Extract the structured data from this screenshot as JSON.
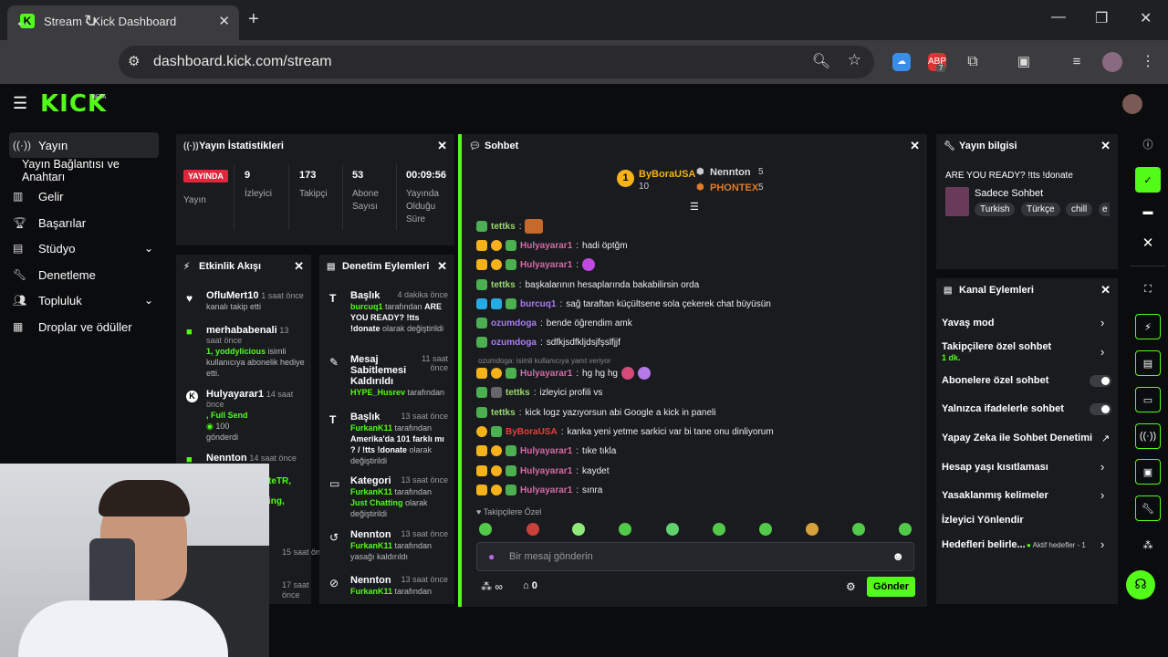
{
  "browser": {
    "tab_title": "Stream - Kick Dashboard",
    "url": "dashboard.kick.com/stream",
    "ext_badge": "7"
  },
  "header": {
    "logo": "KICK",
    "beta": "BETA"
  },
  "nav": {
    "items": [
      {
        "label": "Yayın",
        "icon": "broadcast-icon"
      },
      {
        "label": "Yayın Bağlantısı ve Anahtarı",
        "icon": ""
      },
      {
        "label": "Gelir",
        "icon": "chart-icon"
      },
      {
        "label": "Başarılar",
        "icon": "trophy-icon"
      },
      {
        "label": "Stüdyo",
        "icon": "studio-icon"
      },
      {
        "label": "Denetleme",
        "icon": "wrench-icon"
      },
      {
        "label": "Topluluk",
        "icon": "people-icon"
      },
      {
        "label": "Droplar ve ödüller",
        "icon": "gift-icon"
      }
    ]
  },
  "stats": {
    "title": "Yayın İstatistikleri",
    "live_badge": "YAYINDA",
    "live_label": "Yayın",
    "viewers": "9",
    "viewers_label": "İzleyici",
    "followers": "173",
    "followers_label": "Takipçi",
    "subs": "53",
    "subs_label": "Abone Sayısı",
    "duration": "00:09:56",
    "duration_label": "Yayında Olduğu Süre"
  },
  "activity": {
    "title": "Etkinlik Akışı",
    "items": [
      {
        "user": "OfluMert10",
        "time": "1 saat önce",
        "desc": "kanalı takip etti"
      },
      {
        "user": "merhababenali",
        "time": "13 saat önce",
        "hl": "1, yoddylicious",
        "desc": " isimli kullanıcıya abonelik hediye etti."
      },
      {
        "user": "Hulyayarar1",
        "time": "14 saat önce",
        "hl": ", Full Send",
        "desc": "100",
        "desc2": "gönderdi"
      },
      {
        "user": "Nennton",
        "time": "14 saat önce",
        "hl": "teTR,",
        "desc": ""
      },
      {
        "user": "",
        "time": "15 saat önce",
        "hl": "ing,",
        "desc": ""
      },
      {
        "user": "",
        "time": "17 saat önce",
        "hl": "",
        "desc": ""
      }
    ]
  },
  "moderation": {
    "title": "Denetim Eylemleri",
    "items": [
      {
        "action": "Başlık",
        "time": "4 dakika önce",
        "by": "burcuq1",
        "mid": " tarafından ",
        "bold": "ARE YOU READY? !tts !donate",
        "end": " olarak değiştirildi"
      },
      {
        "action": "Mesaj Sabitlemesi Kaldırıldı",
        "time": "11 saat önce",
        "by": "HYPE_Husrev",
        "mid": " tarafından",
        "bold": "",
        "end": ""
      },
      {
        "action": "Başlık",
        "time": "13 saat önce",
        "by": "FurkanK11",
        "mid": " tarafından ",
        "bold": "Amerika'da 101 farklı mı ? / !tts !donate",
        "end": " olarak değiştirildi"
      },
      {
        "action": "Kategori",
        "time": "13 saat önce",
        "by": "FurkanK11",
        "mid": " tarafından ",
        "bold": "Just Chatting",
        "end": " olarak değiştirildi"
      },
      {
        "action": "Nennton",
        "time": "13 saat önce",
        "by": "FurkanK11",
        "mid": " tarafından yasağı kaldırıldı",
        "bold": "",
        "end": ""
      },
      {
        "action": "Nennton",
        "time": "13 saat önce",
        "by": "FurkanK11",
        "mid": " tarafından",
        "bold": "",
        "end": ""
      }
    ]
  },
  "chat": {
    "title": "Sohbet",
    "top": [
      {
        "name": "ByBoraUSA",
        "count": "10"
      },
      {
        "name": "Nennton",
        "count": "5"
      },
      {
        "name": "PHONTEX",
        "count": "5"
      }
    ],
    "messages": [
      {
        "user": "tettks",
        "color": "green",
        "badges": [
          "money"
        ],
        "text": ""
      },
      {
        "user": "Hulyayarar1",
        "color": "pink",
        "badges": [
          "crown",
          "coin",
          "money"
        ],
        "text": "hadi öptğm"
      },
      {
        "user": "Hulyayarar1",
        "color": "pink",
        "badges": [
          "crown",
          "coin",
          "money"
        ],
        "text": ""
      },
      {
        "user": "tettks",
        "color": "green",
        "badges": [
          "money"
        ],
        "text": "başkalarının hesaplarında bakabilirsin orda"
      },
      {
        "user": "burcuq1",
        "color": "purple",
        "badges": [
          "blue",
          "blue",
          "money"
        ],
        "text": "sağ taraftan küçültsene sola çekerek chat büyüsün"
      },
      {
        "user": "ozumdoga",
        "color": "purple",
        "badges": [
          "money"
        ],
        "text": "bende öğrendim amk"
      },
      {
        "user": "ozumdoga",
        "color": "purple",
        "badges": [
          "money"
        ],
        "text": "sdfkjsdfkljdsjfşslfjjf"
      },
      {
        "user": "Hulyayarar1",
        "color": "pink",
        "badges": [
          "crown",
          "coin",
          "money"
        ],
        "text": "hg hg hg"
      },
      {
        "user": "tettks",
        "color": "green",
        "badges": [
          "money",
          "gray"
        ],
        "text": "izleyici profili vs"
      },
      {
        "user": "tettks",
        "color": "green",
        "badges": [
          "money"
        ],
        "text": "kick logz yazıyorsun abi Google a kick in paneli"
      },
      {
        "user": "ByBoraUSA",
        "color": "red",
        "badges": [
          "coin",
          "money"
        ],
        "text": "kanka yeni yetme sarkici var bi tane onu dinliyorum"
      },
      {
        "user": "Hulyayarar1",
        "color": "pink",
        "badges": [
          "crown",
          "coin",
          "money"
        ],
        "text": "tıke tıkla"
      },
      {
        "user": "Hulyayarar1",
        "color": "pink",
        "badges": [
          "crown",
          "coin",
          "money"
        ],
        "text": "kaydet"
      },
      {
        "user": "Hulyayarar1",
        "color": "pink",
        "badges": [
          "crown",
          "coin",
          "money"
        ],
        "text": "sınra"
      }
    ],
    "reply_note": "ozumdoga: isimli kullanıcıya yanıt veriyor",
    "followers_only": "Takipçilere Özel",
    "placeholder": "Bir mesaj gönderin",
    "points": "∞",
    "store_count": "0",
    "send": "Gönder"
  },
  "stream_info": {
    "title": "Yayın bilgisi",
    "stream_title": "ARE YOU READY? !tts !donate",
    "category": "Sadece Sohbet",
    "tags": [
      "Turkish",
      "Türkçe",
      "chill",
      "e"
    ]
  },
  "channel_actions": {
    "title": "Kanal Eylemleri",
    "items": [
      {
        "label": "Yavaş mod",
        "kind": "chevron"
      },
      {
        "label": "Takipçilere özel sohbet",
        "sub": "1 dk.",
        "kind": "chevron"
      },
      {
        "label": "Abonelere özel sohbet",
        "kind": "toggle"
      },
      {
        "label": "Yalnızca ifadelerle sohbet",
        "kind": "toggle"
      },
      {
        "label": "Yapay Zeka ile Sohbet Denetimi",
        "kind": "external"
      },
      {
        "label": "Hesap yaşı kısıtlaması",
        "kind": "chevron"
      },
      {
        "label": "Yasaklanmış kelimeler",
        "kind": "chevron"
      },
      {
        "label": "İzleyici Yönlendir",
        "kind": "none"
      },
      {
        "label": "Hedefleri belirle...",
        "extra": "Aktif hedefler - 1",
        "kind": "chevron"
      }
    ]
  }
}
